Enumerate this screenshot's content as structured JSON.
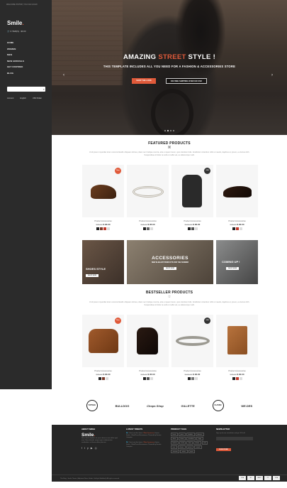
{
  "sidebar": {
    "top_text": "WELCOME VISITOR | YOU CAN LOGIN",
    "logo": "Smile",
    "logo_dot": ".",
    "cart": "0 ITEM(S) - $0.00",
    "nav": [
      "HOME",
      "WOMEN",
      "MEN",
      "NEW ARRIVALS",
      "GET INSPIRED",
      "BLOG"
    ],
    "search_placeholder": "",
    "links": [
      "Account",
      "English",
      "USD Dollar"
    ]
  },
  "hero": {
    "title_pre": "AMAZING ",
    "title_accent": "STREET",
    "title_post": " STYLE !",
    "subtitle": "THIS TEMPLATE INCLUDES ALL YOU NEED FOR A FASHION & ACCESSORIES STORE",
    "btn_primary": "SHOP THE LOOK",
    "btn_secondary": "ON FREE SHIPPING OVER 100 USD",
    "slides": 4,
    "active_slide": 2
  },
  "featured": {
    "title": "FEATURED PRODUCTS",
    "desc": "Ut id ipsum imperdiet lorem viverra blandit. Aliquam ultrices, diam nec tristique viverra, ante ut quam lorem, quis interdum felis. Vestibulum interdum nibh ut mauris, dapibus et, ipsum, eu luctus nibh. Suspendisse id dolor at velit et mollis vel, eu ullamcorper velit.",
    "products": [
      {
        "name": "Product Accessories",
        "price": "$ 90.00",
        "old": "$95.00",
        "badge": "New",
        "badge_type": "sale",
        "swatches": [
          "#222",
          "#7a3a2a",
          "#c0392b",
          "#ddd"
        ]
      },
      {
        "name": "Product Accessories",
        "price": "$ 95.00",
        "old": "$95.00",
        "badge": "",
        "badge_type": "",
        "swatches": [
          "#222",
          "#666",
          "#ddd"
        ]
      },
      {
        "name": "Product Accessories",
        "price": "$ 90.00",
        "old": "$100.00",
        "badge": "-10%",
        "badge_type": "off",
        "swatches": [
          "#222",
          "#555",
          "#ddd"
        ]
      },
      {
        "name": "Product Accessories",
        "price": "$ 90.00",
        "old": "$95.00",
        "badge": "",
        "badge_type": "",
        "swatches": [
          "#222",
          "#c0392b",
          "#ddd"
        ]
      }
    ]
  },
  "banners": {
    "b1_title": "SHOES STYLE",
    "b1_btn": "SHOP NOW",
    "b2_title": "ACCESSORIES",
    "b2_sub": "NEW ELEGANT PRODUCTS FOR THE SUMMER",
    "b2_btn": "SHOP NOW",
    "b3_title": "COMING UP !",
    "b3_btn": "SHOP NOW"
  },
  "bestseller": {
    "title": "BESTSELLER PRODUCTS",
    "desc": "Ut id ipsum imperdiet lorem viverra blandit. Aliquam ultrices, diam nec tristique viverra, ante ut quam lorem, quis interdum felis. Vestibulum interdum nibh ut mauris, dapibus et, ipsum, eu luctus nibh. Suspendisse id dolor at velit et mollis vel, eu ullamcorper velit.",
    "products": [
      {
        "name": "Product Accessories",
        "price": "$ 90.00",
        "old": "$95.00",
        "badge": "New",
        "badge_type": "sale",
        "swatches": [
          "#222",
          "#7a3a2a",
          "#ddd"
        ]
      },
      {
        "name": "Product Accessories",
        "price": "$ 95.00",
        "old": "$95.00",
        "badge": "",
        "badge_type": "",
        "swatches": [
          "#222",
          "#555",
          "#ddd"
        ]
      },
      {
        "name": "Product Accessories",
        "price": "$ 90.00",
        "old": "$100.00",
        "badge": "-10%",
        "badge_type": "off",
        "swatches": [
          "#222",
          "#777",
          "#ddd"
        ]
      },
      {
        "name": "Product Accessories",
        "price": "$ 90.00",
        "old": "$95.00",
        "badge": "",
        "badge_type": "",
        "swatches": [
          "#222",
          "#c0392b",
          "#ddd"
        ]
      }
    ]
  },
  "brands": [
    "VINTAGE",
    "BULLDOG",
    "Chops Shop",
    "GILLETTE",
    "CLASSIC",
    "WE.DES"
  ],
  "footer": {
    "about_title": "ABOUT SMILE",
    "logo": "Smile",
    "about_text": "Nunc libero dapibus mi, quis rhoncus eros dolor eget eros. Nunc blandit, neque eget condimentum vestibulum, vel lorem dolor placerat.",
    "tweets_title": "LATEST TWEETS",
    "tweets": [
      {
        "text": "Check out this latest ",
        "link": "#WooCommerce",
        "rest": " theme Smile - WordPress/Ecommerce Themed by Envato #tutsplus"
      },
      {
        "text": "Check out this latest ",
        "link": "#WooCommerce",
        "rest": " theme Smile - WordPress/Ecommerce Themed by Envato #tutsplus"
      }
    ],
    "tags_title": "PRODUCT TAGS",
    "tags": [
      "boots",
      "jeans",
      "hoodies",
      "dresses",
      "shirts",
      "shoes",
      "sneakers",
      "bags",
      "leather",
      "belts",
      "hats",
      "denim",
      "sale",
      "new",
      "classic",
      "jacket",
      "casual",
      "summer",
      "winter",
      "sport"
    ],
    "newsletter_title": "NEWSLETTER",
    "newsletter_text": "Sign up for our newsletter and get 10% off",
    "newsletter_btn": "SUBSCRIBE",
    "copyright": "The Mag - Smile Theme | Adjusted Store Under LifeStyle Modified | All rights reserved",
    "payments": [
      "VISA",
      "MC",
      "AMEX",
      "PP",
      "VISA"
    ]
  }
}
